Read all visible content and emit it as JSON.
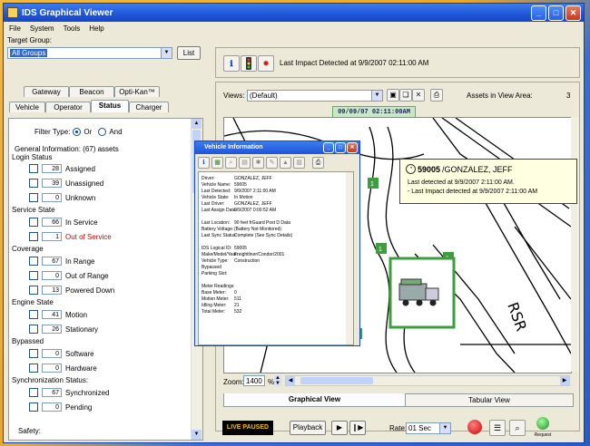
{
  "window": {
    "title": "IDS Graphical Viewer"
  },
  "menu": [
    "File",
    "System",
    "Tools",
    "Help"
  ],
  "left": {
    "target_group_label": "Target Group:",
    "target_group_value": "All Groups",
    "list_button": "List",
    "tabs_row1": [
      "Gateway",
      "Beacon",
      "Opti-Kan™"
    ],
    "tabs_row2": [
      "Vehicle",
      "Operator",
      "Status",
      "Charger"
    ],
    "active_tab": "Status",
    "filter_type_label": "Filter Type:",
    "filter_or": "Or",
    "filter_and": "And",
    "general_info": "General Information: (67) assets",
    "sections": [
      {
        "title": "Login Status",
        "items": [
          {
            "count": "28",
            "label": "Assigned"
          },
          {
            "count": "39",
            "label": "Unassigned"
          },
          {
            "count": "0",
            "label": "Unknown"
          }
        ]
      },
      {
        "title": "Service State",
        "items": [
          {
            "count": "66",
            "label": "In Service"
          },
          {
            "count": "1",
            "label": "Out of Service",
            "red": true
          }
        ]
      },
      {
        "title": "Coverage",
        "items": [
          {
            "count": "67",
            "label": "In Range"
          },
          {
            "count": "0",
            "label": "Out of Range"
          },
          {
            "count": "13",
            "label": "Powered Down"
          }
        ]
      },
      {
        "title": "Engine State",
        "items": [
          {
            "count": "41",
            "label": "Motion"
          },
          {
            "count": "26",
            "label": "Stationary"
          }
        ]
      },
      {
        "title": "Bypassed",
        "items": [
          {
            "count": "0",
            "label": "Software"
          },
          {
            "count": "0",
            "label": "Hardware"
          }
        ]
      },
      {
        "title": "Synchronization Status:",
        "items": [
          {
            "count": "67",
            "label": "Synchronized"
          },
          {
            "count": "0",
            "label": "Pending"
          }
        ]
      }
    ],
    "safety_label": "Safety:"
  },
  "right": {
    "last_impact": "Last Impact Detected at 9/9/2007 02:11:00 AM",
    "views_label": "Views:",
    "views_value": "(Default)",
    "assets_in_view_label": "Assets in View Area:",
    "assets_in_view_value": "3",
    "timestamp": "09/09/07 02:11:00AM",
    "zoom_label": "Zoom:",
    "zoom_value": "1400",
    "zoom_unit": "%",
    "tab_graphical": "Graphical View",
    "tab_tabular": "Tabular View",
    "live_paused": "LIVE PAUSED",
    "playback": "Playback",
    "rate_label": "Rate:",
    "rate_value": "01 Sec",
    "request_label": "Request",
    "map_markers": [
      "1",
      "1",
      "1",
      "1"
    ],
    "map_road": "RSR"
  },
  "tooltip": {
    "vehicle_id": "59005",
    "driver": "/GONZALEZ, JEFF",
    "line1": "Last detected at 9/9/2007 2:11:00 AM.",
    "line2": "- Last Impact detected at 9/9/2007 2:11:00 AM"
  },
  "vehicle_info": {
    "title": "Vehicle Information",
    "rows": [
      [
        "Driver:",
        "GONZALEZ, JEFF"
      ],
      [
        "Vehicle Name:",
        "59005"
      ],
      [
        "Last Detected:",
        "9/9/2007 2:11:00 AM"
      ],
      [
        "Vehicle State:",
        "In Motion"
      ],
      [
        "Last Driver:",
        "GONZALEZ, JEFF"
      ],
      [
        "Last Assign Date:",
        "9/9/2007 0:00:52 AM"
      ],
      [
        "",
        ""
      ],
      [
        "Last Location:",
        "90 feet frGuard Post D Data"
      ],
      [
        "Battery Voltage:",
        "(Battery Not Monitored)"
      ],
      [
        "Last Sync Status:",
        "Complete (See Sync Details)"
      ],
      [
        "",
        ""
      ],
      [
        "IDS Logical ID:",
        "59005"
      ],
      [
        "Make/Model/Year:",
        "Freightliner/Condor/2001"
      ],
      [
        "Vehicle Type:",
        "Construction"
      ],
      [
        "Bypassed",
        ""
      ],
      [
        "Parking Slot:",
        ""
      ],
      [
        "",
        ""
      ],
      [
        "Meter Readings:",
        ""
      ],
      [
        "Base Meter:",
        "0"
      ],
      [
        "Motion Meter:",
        "511"
      ],
      [
        "Idling Meter:",
        "21"
      ],
      [
        "Total Meter:",
        "532"
      ]
    ]
  },
  "colors": {
    "title_blue": "#1f55d8",
    "live_paused_bg": "#000000",
    "live_paused_fg": "#f0c000",
    "accent_green": "#3c9e3c"
  }
}
